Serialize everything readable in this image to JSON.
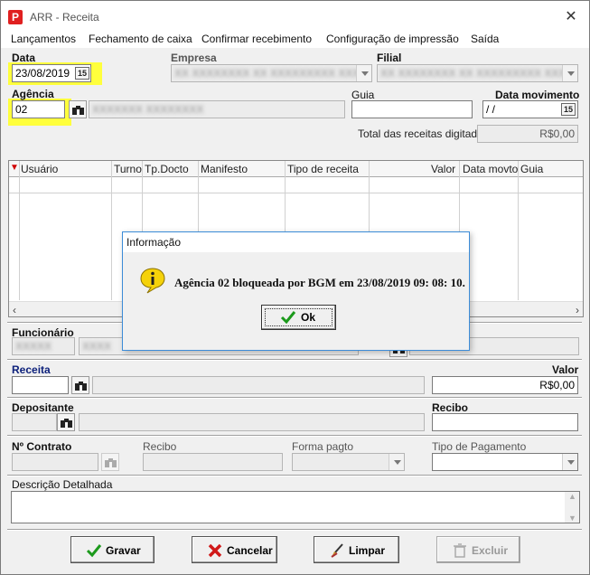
{
  "window": {
    "title": "ARR - Receita",
    "icon": "app-logo-icon"
  },
  "menu": [
    "Lançamentos",
    "Fechamento de caixa",
    "Confirmar recebimento",
    "Configuração de impressão",
    "Saída"
  ],
  "header": {
    "data_label": "Data",
    "data_value": "23/08/2019",
    "empresa_label": "Empresa",
    "empresa_value": "XX XXXXXXXX XX XXXXXXXXX XXXX",
    "filial_label": "Filial",
    "filial_value": "XX XXXXXXXX XX XXXXXXXXX XXXX",
    "agencia_label": "Agência",
    "agencia_value": "02",
    "agencia_desc": "XXXXXXX  XXXXXXXX",
    "guia_label": "Guia",
    "guia_value": "",
    "data_mov_label": "Data movimento",
    "data_mov_value": " / /",
    "total_label": "Total das receitas digitadas",
    "total_value": "R$0,00"
  },
  "grid": {
    "columns": [
      "Usuário",
      "Turno",
      "Tp.Docto",
      "Manifesto",
      "Tipo de receita",
      "Valor",
      "Data movto",
      "Guia"
    ]
  },
  "dialog": {
    "title": "Informação",
    "message": "Agência 02 bloqueada por BGM em 23/08/2019 09: 08: 10.",
    "ok_label": "Ok"
  },
  "funcionario": {
    "label": "Funcionário",
    "code": "XXXXX",
    "name": "XXXX"
  },
  "receita": {
    "label": "Receita",
    "valor_label": "Valor",
    "valor_value": "R$0,00",
    "code": "",
    "desc": ""
  },
  "depositante": {
    "label": "Depositante",
    "recibo_label": "Recibo",
    "recibo_value": ""
  },
  "contrato": {
    "label": "Nº Contrato",
    "recibo_label": "Recibo",
    "forma_label": "Forma pagto",
    "tipo_label": "Tipo de Pagamento"
  },
  "descricao": {
    "label": "Descrição Detalhada",
    "value": ""
  },
  "buttons": {
    "gravar": "Gravar",
    "cancelar": "Cancelar",
    "limpar": "Limpar",
    "excluir": "Excluir"
  },
  "colors": {
    "highlight": "#ffff3c",
    "dialog_border": "#3c8cd8",
    "label_blue": "#0b1f7a"
  }
}
